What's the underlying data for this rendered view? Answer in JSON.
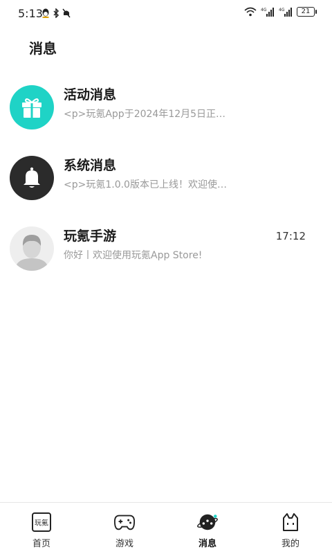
{
  "status_bar": {
    "time": "5:13",
    "battery": "21"
  },
  "header": {
    "title": "消息"
  },
  "messages": [
    {
      "title": "活动消息",
      "preview": "<p>玩氪App于2024年12月5日正…",
      "time": "",
      "avatar_icon": "gift-icon",
      "avatar_color": "#1fd3c6"
    },
    {
      "title": "系统消息",
      "preview": "<p>玩氪1.0.0版本已上线！欢迎使…",
      "time": "",
      "avatar_icon": "bell-icon",
      "avatar_color": "#2b2b2b"
    },
    {
      "title": "玩氪手游",
      "preview": "你好丨欢迎使用玩氪App Store!",
      "time": "17:12",
      "avatar_icon": "default-user-avatar",
      "avatar_color": "#eeeeee"
    }
  ],
  "bottom_nav": {
    "items": [
      {
        "label": "首页",
        "icon": "home-logo-icon",
        "active": false
      },
      {
        "label": "游戏",
        "icon": "gamepad-icon",
        "active": false
      },
      {
        "label": "消息",
        "icon": "message-planet-icon",
        "active": true
      },
      {
        "label": "我的",
        "icon": "cat-face-icon",
        "active": false
      }
    ],
    "home_logo_text": "玩氪"
  }
}
